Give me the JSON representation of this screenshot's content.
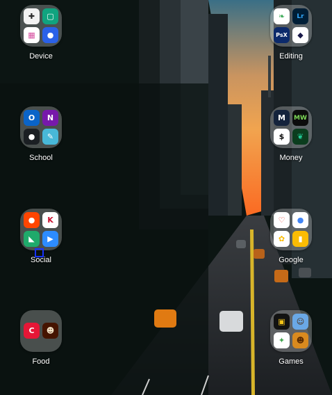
{
  "folders": [
    {
      "label": "Device",
      "apps": [
        {
          "icon": "device-care-icon",
          "glyph": "✚",
          "bg": "#f2f2f2",
          "fg": "#2a2a2a"
        },
        {
          "icon": "phone-screen-icon",
          "glyph": "▢",
          "bg": "#10a37f",
          "fg": "#ffffff"
        },
        {
          "icon": "grid-app-icon",
          "glyph": "▦",
          "bg": "#ffffff",
          "fg": "#d64fa0"
        },
        {
          "icon": "bixby-icon",
          "glyph": "●",
          "bg": "#2a61e8",
          "fg": "#ffffff"
        }
      ]
    },
    {
      "label": "Editing",
      "apps": [
        {
          "icon": "snapseed-icon",
          "glyph": "❧",
          "bg": "#ffffff",
          "fg": "#38a853"
        },
        {
          "icon": "lightroom-icon",
          "glyph": "Lr",
          "bg": "#001e36",
          "fg": "#31a8ff"
        },
        {
          "icon": "photoshop-express-icon",
          "glyph": "PsX",
          "bg": "#0c2a6b",
          "fg": "#ffffff"
        },
        {
          "icon": "gallery-editor-icon",
          "glyph": "◆",
          "bg": "#ffffff",
          "fg": "#1a1a4a"
        }
      ]
    },
    {
      "label": "School",
      "apps": [
        {
          "icon": "outlook-icon",
          "glyph": "O",
          "bg": "#0a64c8",
          "fg": "#ffffff"
        },
        {
          "icon": "onenote-icon",
          "glyph": "N",
          "bg": "#7719aa",
          "fg": "#ffffff"
        },
        {
          "icon": "github-icon",
          "glyph": "●",
          "bg": "#1b1f23",
          "fg": "#ffffff"
        },
        {
          "icon": "pencil-app-icon",
          "glyph": "✎",
          "bg": "#48b8d8",
          "fg": "#ffffff"
        }
      ]
    },
    {
      "label": "Money",
      "apps": [
        {
          "icon": "monzo-icon",
          "glyph": "M",
          "bg": "#14233c",
          "fg": "#ffffff"
        },
        {
          "icon": "money-wallet-icon",
          "glyph": "MW",
          "bg": "#0c0c0c",
          "fg": "#7dd957"
        },
        {
          "icon": "zelle-icon",
          "glyph": "$",
          "bg": "#ffffff",
          "fg": "#111111"
        },
        {
          "icon": "robinhood-icon",
          "glyph": "❦",
          "bg": "#0b3d1e",
          "fg": "#21ce99"
        }
      ]
    },
    {
      "label": "Social",
      "apps": [
        {
          "icon": "reddit-icon",
          "glyph": "●",
          "bg": "#ff4500",
          "fg": "#ffffff"
        },
        {
          "icon": "kik-icon",
          "glyph": "K",
          "bg": "#ffffff",
          "fg": "#c8102e"
        },
        {
          "icon": "social-app-icon",
          "glyph": "◣",
          "bg": "#1faa6b",
          "fg": "#ffffff"
        },
        {
          "icon": "zoom-icon",
          "glyph": "▶",
          "bg": "#2d8cff",
          "fg": "#ffffff"
        }
      ]
    },
    {
      "label": "Google",
      "apps": [
        {
          "icon": "google-fit-icon",
          "glyph": "♡",
          "bg": "#ffffff",
          "fg": "#e94235"
        },
        {
          "icon": "google-assistant-icon",
          "glyph": "●",
          "bg": "#ffffff",
          "fg": "#4285f4"
        },
        {
          "icon": "google-photos-icon",
          "glyph": "✿",
          "bg": "#ffffff",
          "fg": "#fbbc04"
        },
        {
          "icon": "google-keep-icon",
          "glyph": "▮",
          "bg": "#fbbc04",
          "fg": "#ffffff"
        }
      ]
    },
    {
      "label": "Food",
      "apps": [
        {
          "icon": "chick-fil-a-icon",
          "glyph": "C",
          "bg": "#e51636",
          "fg": "#ffffff"
        },
        {
          "icon": "chipotle-icon",
          "glyph": "☻",
          "bg": "#451400",
          "fg": "#f2e3c6"
        }
      ]
    },
    {
      "label": "Games",
      "apps": [
        {
          "icon": "puzzle-game-icon",
          "glyph": "▣",
          "bg": "#121212",
          "fg": "#f5c518"
        },
        {
          "icon": "character-game-icon",
          "glyph": "☺",
          "bg": "#6aa8e6",
          "fg": "#4a2a10"
        },
        {
          "icon": "arcade-game-icon",
          "glyph": "✦",
          "bg": "#ffffff",
          "fg": "#3fa34d"
        },
        {
          "icon": "clash-game-icon",
          "glyph": "☻",
          "bg": "#d98a1f",
          "fg": "#5a2a00"
        }
      ]
    }
  ]
}
